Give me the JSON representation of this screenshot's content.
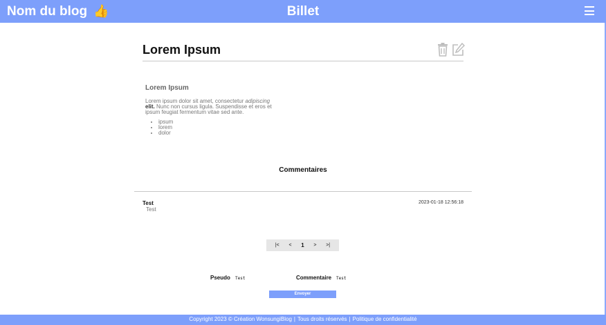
{
  "header": {
    "blog_name": "Nom du blog",
    "title": "Billet",
    "icons": {
      "brand": "thumbs-up-icon",
      "menu": "hamburger-menu-icon"
    }
  },
  "post": {
    "title": "Lorem Ipsum",
    "actions": {
      "delete": "trash-icon",
      "edit": "edit-icon"
    },
    "content": {
      "heading": "Lorem Ipsum",
      "paragraph_start": "Lorem ipsum dolor sit amet, consectetur ",
      "paragraph_italic": "adipiscing",
      "paragraph_bold": "elit.",
      "paragraph_end": "Nunc non cursus ligula. Suspendisse et eros et ipsum feugiat fermentum vitae sed ante.",
      "list": [
        "ipsum",
        "lorem",
        "dolor"
      ]
    }
  },
  "comments": {
    "heading": "Commentaires",
    "items": [
      {
        "author": "Test",
        "text": "Test",
        "date": "2023-01-18 12:56:18"
      }
    ]
  },
  "pagination": {
    "first": "|<",
    "prev": "<",
    "current": "1",
    "next": ">",
    "last": ">|"
  },
  "form": {
    "pseudo_label": "Pseudo",
    "pseudo_value": "Test",
    "comment_label": "Commentaire",
    "comment_value": "Test",
    "submit_label": "Envoyer"
  },
  "footer": {
    "copyright": "Copyright 2023 © Création WonsungiBlog",
    "rights": "Tous droits réservés",
    "privacy": "Politique de confidentialité",
    "separator": "|"
  },
  "colors": {
    "accent": "#7d9ffb",
    "pager_bg": "#e6e6e6",
    "text_muted": "#777777"
  }
}
